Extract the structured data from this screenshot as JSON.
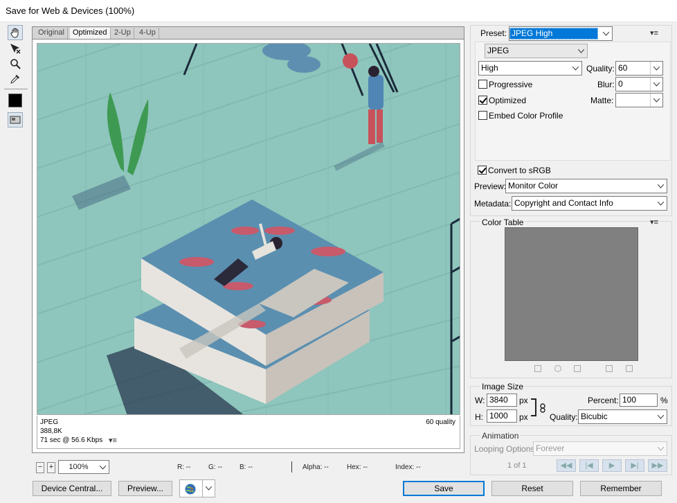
{
  "window": {
    "title": "Save for Web & Devices (100%)"
  },
  "tools": {
    "items": [
      {
        "name": "hand-tool-icon"
      },
      {
        "name": "slice-select-tool-icon"
      },
      {
        "name": "zoom-tool-icon"
      },
      {
        "name": "eyedropper-tool-icon"
      },
      {
        "name": "eyedropper-color-swatch"
      },
      {
        "name": "toggle-slices-visibility-icon"
      }
    ],
    "swatch_color": "#000000"
  },
  "view_tabs": [
    "Original",
    "Optimized",
    "2-Up",
    "4-Up"
  ],
  "view_tabs_active": "Optimized",
  "image_info": {
    "format": "JPEG",
    "size": "388,8K",
    "time": "71 sec @ 56.6 Kbps",
    "quality": "60 quality"
  },
  "status": {
    "zoom": "100%",
    "r": "R: --",
    "g": "G: --",
    "b": "B: --",
    "alpha": "Alpha: --",
    "hex": "Hex: --",
    "index": "Index: --"
  },
  "buttons": {
    "device_central": "Device Central...",
    "preview": "Preview...",
    "save": "Save",
    "reset": "Reset",
    "remember": "Remember"
  },
  "settings": {
    "preset_label": "Preset:",
    "preset_value": "JPEG High",
    "format_value": "JPEG",
    "quality_preset": "High",
    "quality_label": "Quality:",
    "quality_value": "60",
    "progressive_label": "Progressive",
    "progressive_checked": false,
    "blur_label": "Blur:",
    "blur_value": "0",
    "optimized_label": "Optimized",
    "optimized_checked": true,
    "matte_label": "Matte:",
    "matte_value": "",
    "embed_profile_label": "Embed Color Profile",
    "embed_profile_checked": false,
    "convert_srgb_label": "Convert to sRGB",
    "convert_srgb_checked": true,
    "preview_label": "Preview:",
    "preview_value": "Monitor Color",
    "metadata_label": "Metadata:",
    "metadata_value": "Copyright and Contact Info"
  },
  "color_table": {
    "title": "Color Table",
    "bg_color": "#808080"
  },
  "image_size": {
    "title": "Image Size",
    "w_label": "W:",
    "w_value": "3840",
    "h_label": "H:",
    "h_value": "1000",
    "unit": "px",
    "percent_label": "Percent:",
    "percent_value": "100",
    "percent_unit": "%",
    "quality_label": "Quality:",
    "quality_value": "Bicubic"
  },
  "animation": {
    "title": "Animation",
    "looping_label": "Looping Options:",
    "looping_value": "Forever",
    "frame_counter": "1 of 1"
  },
  "colors": {
    "accent": "#0078d7",
    "art_bg": "#8ec5bc",
    "book_blue": "#5b8fb0",
    "book_red": "#c75a6b"
  }
}
